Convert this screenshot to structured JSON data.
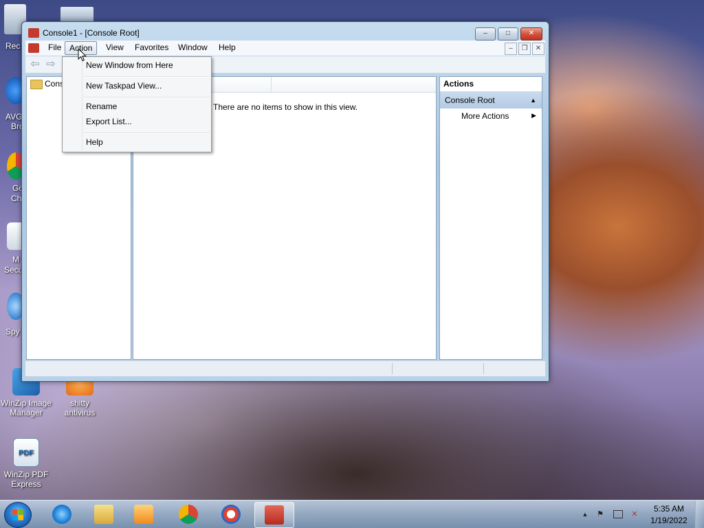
{
  "desktop": {
    "icons": [
      {
        "label": "WinZip Image Manager"
      },
      {
        "label": "shitty antivirus"
      },
      {
        "label": "WinZip PDF Express"
      }
    ],
    "partial_labels": [
      "Rec",
      "AVG",
      "Bro",
      "Go",
      "Ch",
      "M",
      "Secu",
      "Spy"
    ]
  },
  "window": {
    "title": "Console1 - [Console Root]",
    "caption": {
      "minimize": "–",
      "maximize": "□",
      "close": "✕"
    },
    "menu": [
      "File",
      "Action",
      "View",
      "Favorites",
      "Window",
      "Help"
    ],
    "mdi_controls": {
      "minimize": "–",
      "restore": "❐",
      "close": "✕"
    },
    "toolbar": {
      "back": "⇦",
      "forward": "⇨"
    },
    "tree": {
      "root_label": "Cons"
    },
    "center": {
      "empty_message": "There are no items to show in this view."
    },
    "actions": {
      "header": "Actions",
      "section": "Console Root",
      "items": [
        "More Actions"
      ]
    }
  },
  "action_menu": {
    "items": [
      "New Window from Here",
      "New Taskpad View...",
      "Rename",
      "Export List...",
      "Help"
    ]
  },
  "taskbar": {
    "time": "5:35 AM",
    "date": "1/19/2022",
    "tray_arrow": "▲",
    "tray_flag": "⚑"
  },
  "colors": {
    "accent": "#2a7ad1",
    "actions_section": "#c9dbee",
    "close_button": "#c0321f"
  }
}
